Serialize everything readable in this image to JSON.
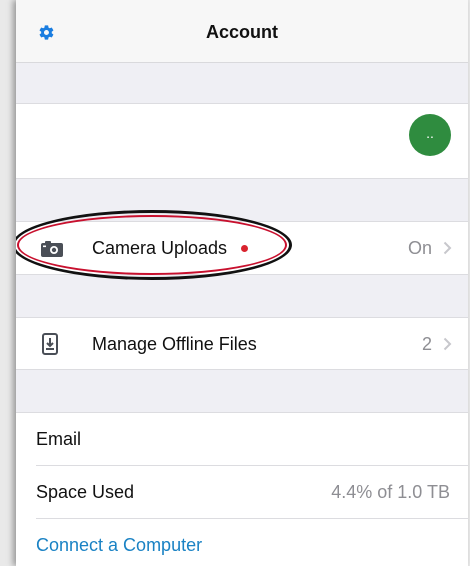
{
  "navbar": {
    "title": "Account",
    "settings_icon": "gear-icon",
    "accent": "#1a7de0"
  },
  "profile": {
    "avatar_initials": "..",
    "avatar_color": "#2f8c3f"
  },
  "rows": [
    {
      "label": "Camera Uploads",
      "value": "On",
      "icon": "camera-icon",
      "has_dot": true,
      "dot_color": "#d9232e"
    },
    {
      "label": "Manage Offline Files",
      "value": "2",
      "icon": "offline-file-icon"
    }
  ],
  "info": {
    "email_label": "Email",
    "space_label": "Space Used",
    "space_value": "4.4% of 1.0 TB",
    "connect_label": "Connect a Computer",
    "link_color": "#1a82c4"
  }
}
